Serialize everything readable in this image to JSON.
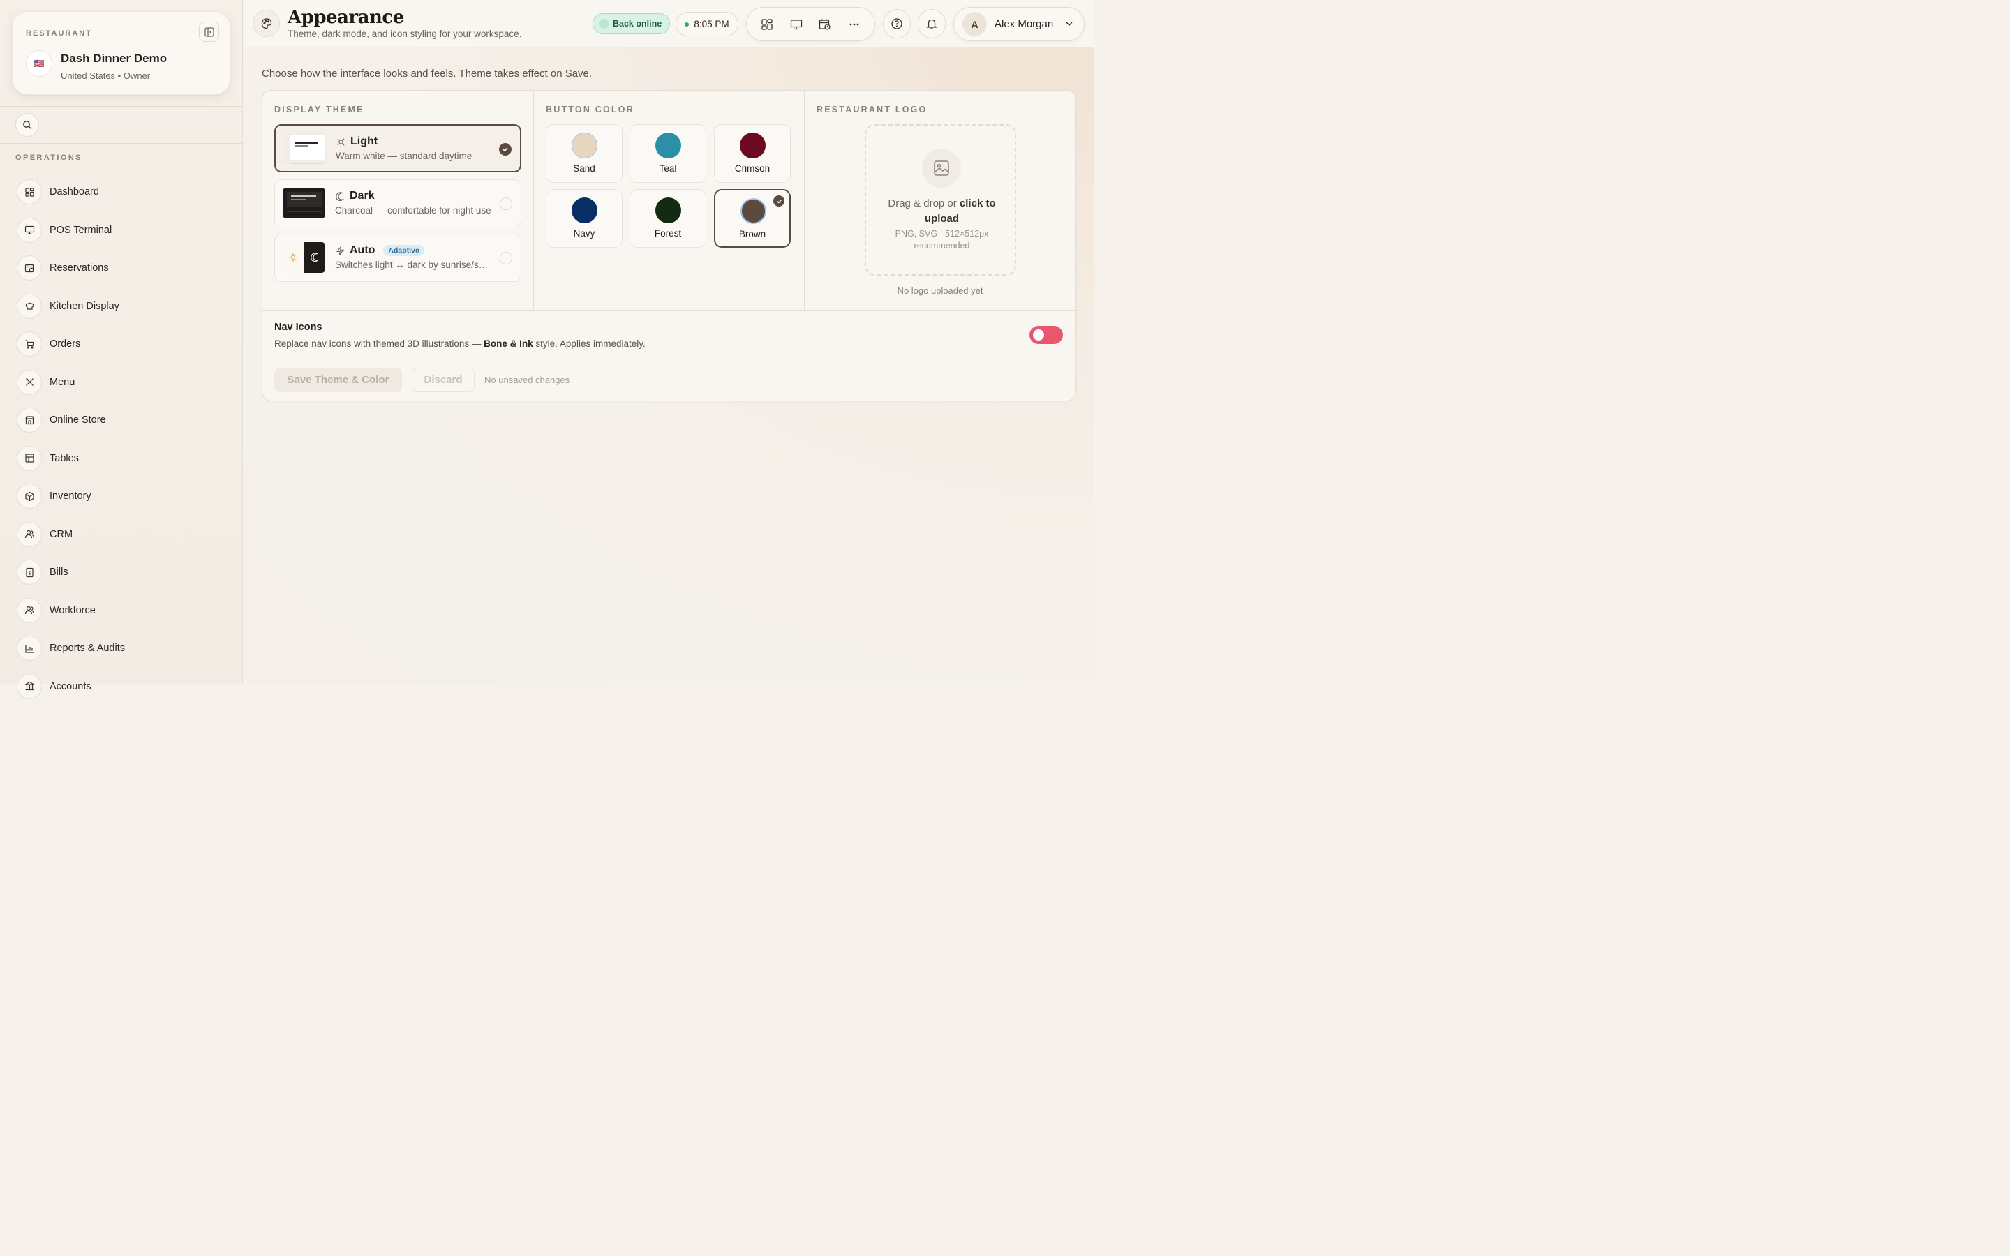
{
  "sidebar": {
    "restaurant_label": "RESTAURANT",
    "restaurant_name": "Dash Dinner Demo",
    "restaurant_sub": "United States • Owner",
    "flag": "🇺🇸",
    "section_label": "OPERATIONS",
    "items": [
      {
        "label": "Dashboard",
        "icon": "dashboard-icon"
      },
      {
        "label": "POS Terminal",
        "icon": "monitor-icon"
      },
      {
        "label": "Reservations",
        "icon": "calendar-clock-icon"
      },
      {
        "label": "Kitchen Display",
        "icon": "chef-hat-icon"
      },
      {
        "label": "Orders",
        "icon": "cart-icon"
      },
      {
        "label": "Menu",
        "icon": "utensils-icon"
      },
      {
        "label": "Online Store",
        "icon": "store-icon"
      },
      {
        "label": "Tables",
        "icon": "table-icon"
      },
      {
        "label": "Inventory",
        "icon": "box-icon"
      },
      {
        "label": "CRM",
        "icon": "users-icon"
      },
      {
        "label": "Bills",
        "icon": "receipt-icon"
      },
      {
        "label": "Workforce",
        "icon": "team-icon"
      },
      {
        "label": "Reports & Audits",
        "icon": "bar-chart-icon"
      },
      {
        "label": "Accounts",
        "icon": "bank-icon"
      }
    ]
  },
  "header": {
    "title": "Appearance",
    "subtitle": "Theme, dark mode, and icon styling for your workspace.",
    "status": "Back online",
    "time": "8:05 PM",
    "user_initial": "A",
    "user_name": "Alex Morgan"
  },
  "main": {
    "intro": "Choose how the interface looks and feels. Theme takes effect on Save.",
    "display_theme": {
      "heading": "DISPLAY THEME",
      "options": [
        {
          "name": "Light",
          "desc": "Warm white — standard daytime",
          "selected": true
        },
        {
          "name": "Dark",
          "desc": "Charcoal — comfortable for night use",
          "selected": false
        },
        {
          "name": "Auto",
          "desc": "Switches light ↔ dark by sunrise/sunset",
          "badge": "Adaptive",
          "selected": false
        }
      ]
    },
    "button_color": {
      "heading": "BUTTON COLOR",
      "swatches": [
        {
          "name": "Sand",
          "color": "#e9d6c1"
        },
        {
          "name": "Teal",
          "color": "#2b8fa6"
        },
        {
          "name": "Crimson",
          "color": "#6d0a22"
        },
        {
          "name": "Navy",
          "color": "#072f66"
        },
        {
          "name": "Forest",
          "color": "#132a13"
        },
        {
          "name": "Brown",
          "color": "#5d4a3e",
          "selected": true
        }
      ]
    },
    "logo": {
      "heading": "RESTAURANT LOGO",
      "drop_prefix": "Drag & drop or ",
      "drop_link": "click to upload",
      "hint": "PNG, SVG · 512×512px recommended",
      "status": "No logo uploaded yet"
    },
    "nav_icons": {
      "title": "Nav Icons",
      "desc_prefix": "Replace nav icons with themed 3D illustrations — ",
      "desc_style": "Bone & Ink",
      "desc_suffix": " style. Applies immediately.",
      "enabled": false
    },
    "actions": {
      "save": "Save Theme & Color",
      "discard": "Discard",
      "status": "No unsaved changes"
    }
  },
  "colors": {
    "accent": "#5a4b40",
    "online_green": "#2fa860",
    "toggle_off": "#e8576e"
  }
}
